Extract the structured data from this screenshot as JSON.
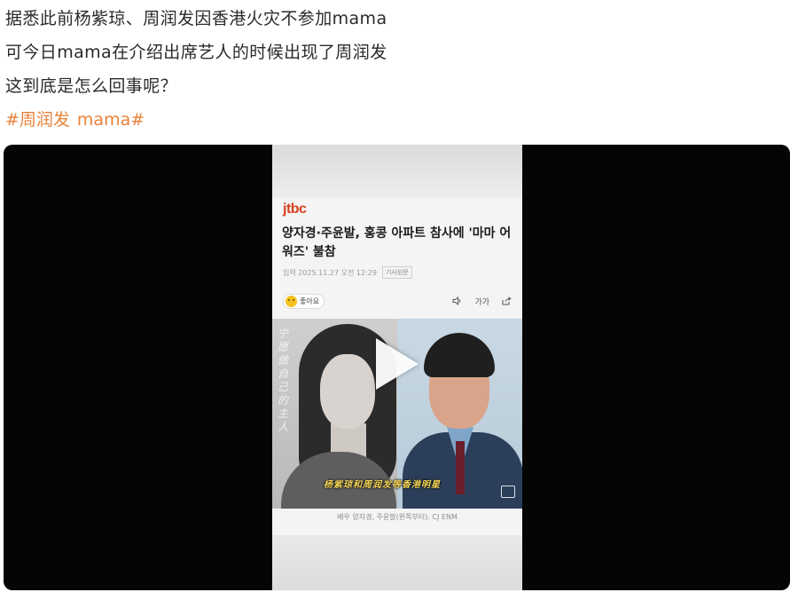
{
  "post": {
    "lines": [
      "据悉此前杨紫琼、周润发因香港火灾不参加mama",
      "可今日mama在介绍出席艺人的时候出现了周润发",
      "这到底是怎么回事呢？"
    ],
    "hashtags": [
      "#周润发",
      "mama#"
    ]
  },
  "video": {
    "article": {
      "source_logo": "jtbc",
      "headline": "양자경·주윤발, 홍콩 아파트 참사에 '마마 어워즈' 불참",
      "meta_date": "입력 2025.11.27 오전 12:29",
      "meta_badge": "기사원문",
      "reaction_label": "좋아요",
      "tools": [
        "speaker-icon",
        "font-size-icon",
        "share-icon"
      ],
      "font_size_label": "가가"
    },
    "photo": {
      "calligraphy": "宁愿做自己的主人",
      "caption": "杨紫琼和周润发等香港明星",
      "credit": "배우 양자경, 주윤발(왼쪽부터). CJ ENM"
    },
    "colors": {
      "hashtag": "#e8823a",
      "player_bg": "#050505",
      "jtbc": "#d8401f",
      "caption": "#f6d75a"
    }
  }
}
